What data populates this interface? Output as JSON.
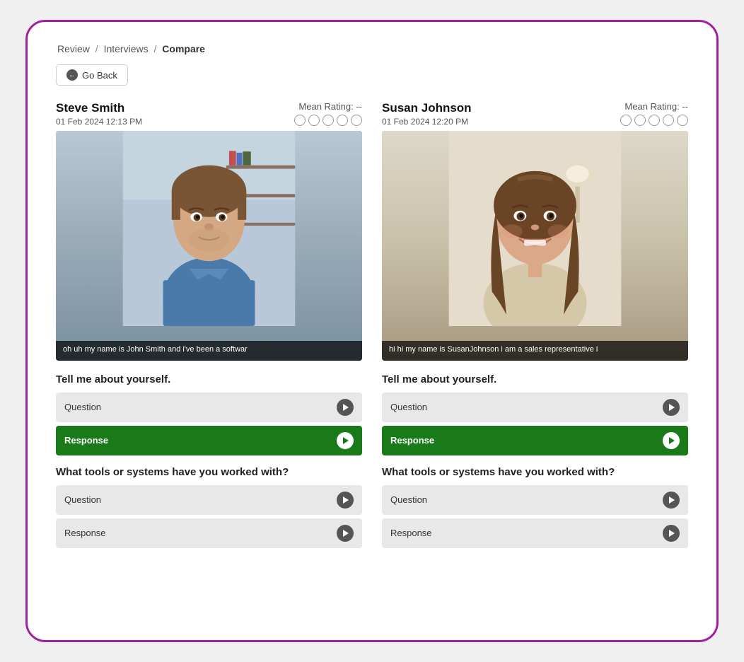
{
  "breadcrumb": {
    "items": [
      {
        "label": "Review",
        "active": false
      },
      {
        "label": "Interviews",
        "active": false
      },
      {
        "label": "Compare",
        "active": true
      }
    ]
  },
  "go_back_button": "Go Back",
  "candidates": [
    {
      "id": "candidate-1",
      "name": "Steve Smith",
      "date": "01 Feb 2024 12:13 PM",
      "mean_rating_label": "Mean Rating: --",
      "subtitle": "oh uh my name is John Smith and i've been a softwar",
      "questions": [
        {
          "section_title": "Tell me about yourself.",
          "rows": [
            {
              "label": "Question",
              "active": false
            },
            {
              "label": "Response",
              "active": true
            }
          ]
        },
        {
          "section_title": "What tools or systems have you worked with?",
          "rows": [
            {
              "label": "Question",
              "active": false
            },
            {
              "label": "Response",
              "active": false
            }
          ]
        }
      ]
    },
    {
      "id": "candidate-2",
      "name": "Susan Johnson",
      "date": "01 Feb 2024 12:20 PM",
      "mean_rating_label": "Mean Rating: --",
      "subtitle": "hi hi my name is SusanJohnson i am a sales representative i",
      "questions": [
        {
          "section_title": "Tell me about yourself.",
          "rows": [
            {
              "label": "Question",
              "active": false
            },
            {
              "label": "Response",
              "active": true
            }
          ]
        },
        {
          "section_title": "What tools or systems have you worked with?",
          "rows": [
            {
              "label": "Question",
              "active": false
            },
            {
              "label": "Response",
              "active": false
            }
          ]
        }
      ]
    }
  ],
  "rating_count": 5,
  "colors": {
    "active_green": "#1a7a1a",
    "border_purple": "#a020a0"
  }
}
